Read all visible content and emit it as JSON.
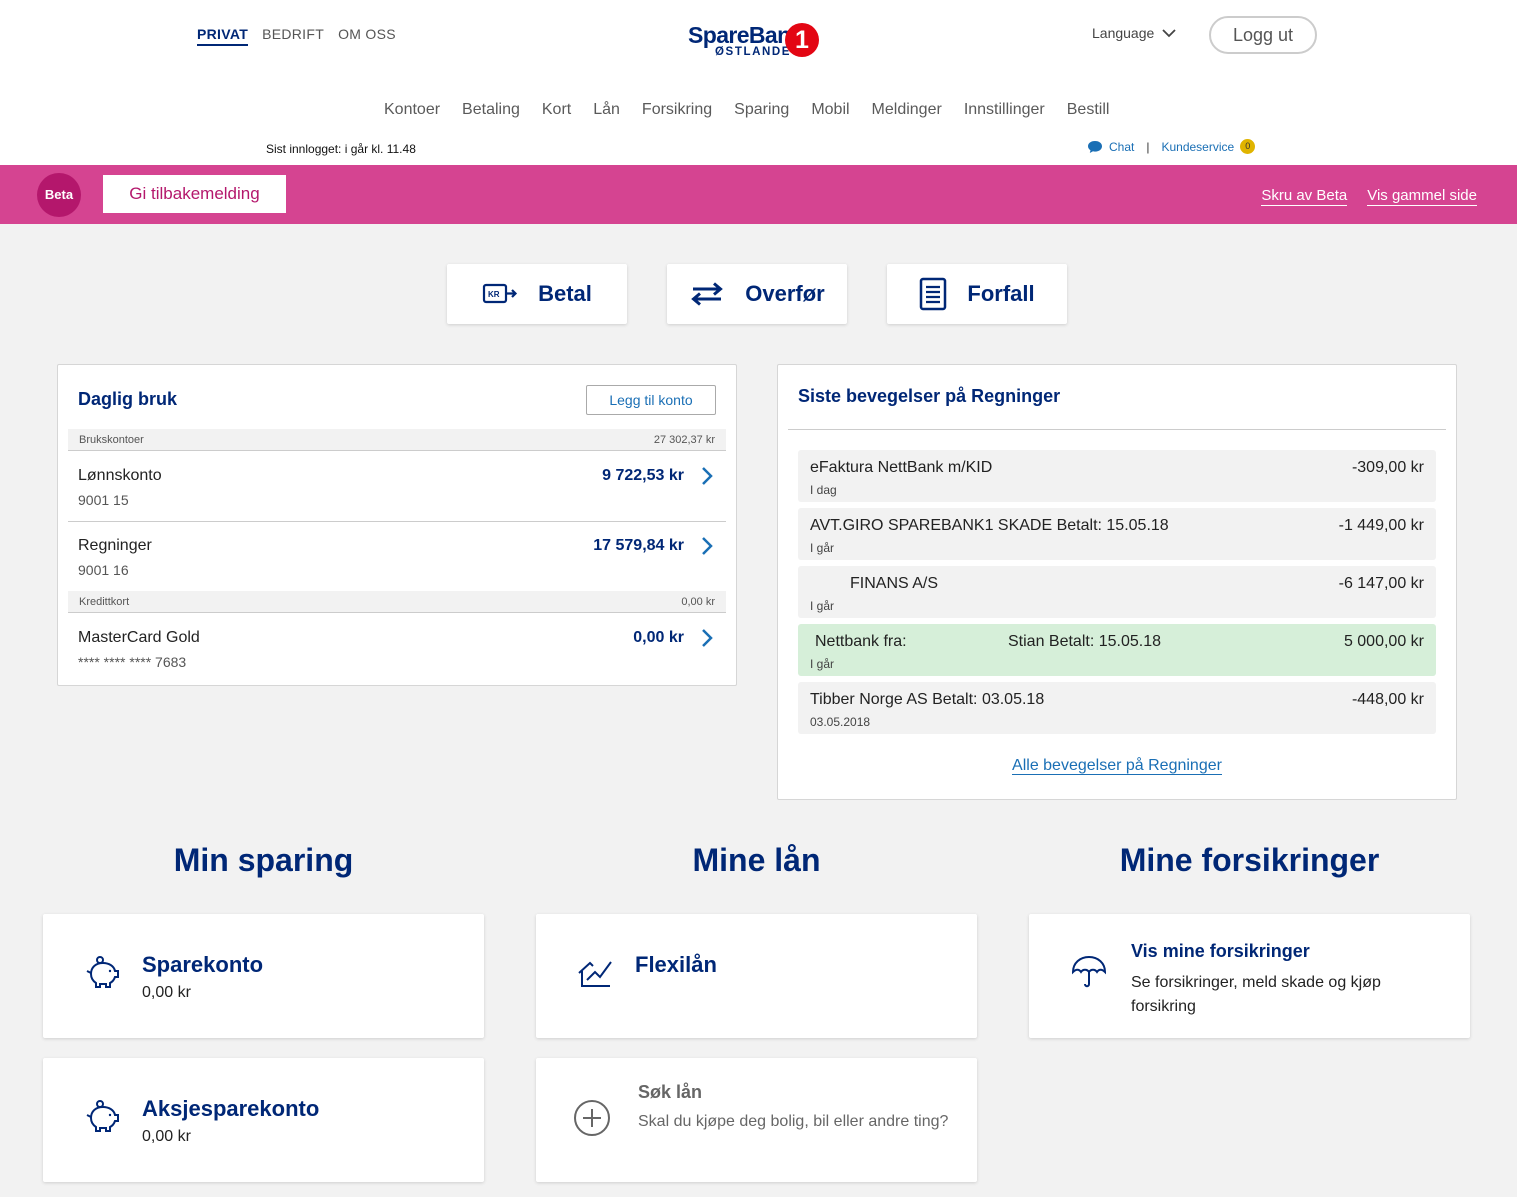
{
  "header": {
    "top_links": [
      "PRIVAT",
      "BEDRIFT",
      "OM OSS"
    ],
    "logo": {
      "line1": "SpareBank",
      "line2": "ØSTLANDET",
      "mark": "1"
    },
    "language_label": "Language",
    "logout_label": "Logg ut",
    "main_nav": [
      "Kontoer",
      "Betaling",
      "Kort",
      "Lån",
      "Forsikring",
      "Sparing",
      "Mobil",
      "Meldinger",
      "Innstillinger",
      "Bestill"
    ],
    "last_login": "Sist innlogget: i går kl. 11.48",
    "chat_label": "Chat",
    "separator": "|",
    "customer_service_label": "Kundeservice",
    "customer_service_count": "0"
  },
  "beta_bar": {
    "badge": "Beta",
    "feedback_label": "Gi tilbakemelding",
    "disable_beta_label": "Skru av Beta",
    "old_page_label": "Vis gammel side"
  },
  "quick_actions": [
    {
      "label": "Betal",
      "icon": "kr-transfer-icon"
    },
    {
      "label": "Overfør",
      "icon": "swap-arrows-icon"
    },
    {
      "label": "Forfall",
      "icon": "document-list-icon"
    }
  ],
  "daily": {
    "title": "Daglig bruk",
    "add_account_label": "Legg til konto",
    "group1": {
      "label": "Brukskontoer",
      "total": "27 302,37 kr"
    },
    "accounts": [
      {
        "name": "Lønnskonto",
        "number": "9001 15",
        "amount": "9 722,53 kr"
      },
      {
        "name": "Regninger",
        "number": "9001 16",
        "amount": "17 579,84 kr"
      }
    ],
    "group2": {
      "label": "Kredittkort",
      "total": "0,00 kr"
    },
    "card": {
      "name": "MasterCard Gold",
      "number": "**** **** **** 7683",
      "amount": "0,00 kr"
    }
  },
  "transactions": {
    "title": "Siste bevegelser på Regninger",
    "items": [
      {
        "desc": "eFaktura NettBank m/KID",
        "date": "I dag",
        "amount": "-309,00 kr"
      },
      {
        "desc": "AVT.GIRO SPAREBANK1 SKADE Betalt: 15.05.18",
        "date": "I går",
        "amount": "-1 449,00 kr"
      },
      {
        "desc": "FINANS A/S",
        "date": "I går",
        "amount": "-6 147,00 kr"
      },
      {
        "desc": "Nettbank fra:",
        "desc2": "Stian Betalt: 15.05.18",
        "date": "I går",
        "amount": "5 000,00 kr"
      },
      {
        "desc": "Tibber Norge AS Betalt: 03.05.18",
        "date": "03.05.2018",
        "amount": "-448,00 kr"
      }
    ],
    "all_label": "Alle bevegelser på Regninger"
  },
  "sections": {
    "saving": {
      "title": "Min sparing",
      "items": [
        {
          "title": "Sparekonto",
          "value": "0,00 kr",
          "icon": "piggy-bank-icon"
        },
        {
          "title": "Aksjesparekonto",
          "value": "0,00 kr",
          "icon": "piggy-bank-icon"
        }
      ]
    },
    "loans": {
      "title": "Mine lån",
      "items": [
        {
          "title": "Flexilån",
          "icon": "house-chart-icon"
        },
        {
          "title": "Søk lån",
          "subtitle": "Skal du kjøpe deg bolig, bil eller andre ting?",
          "icon": "plus-circle-icon"
        }
      ]
    },
    "insurance": {
      "title": "Mine forsikringer",
      "items": [
        {
          "title": "Vis mine forsikringer",
          "subtitle": "Se forsikringer, meld skade og kjøp forsikring",
          "icon": "umbrella-icon"
        }
      ]
    }
  },
  "colors": {
    "brand_blue": "#002776",
    "beta_pink": "#d54491",
    "link_blue": "#1a6fb5",
    "logo_red": "#e30613",
    "positive_green": "#d6efd9"
  }
}
